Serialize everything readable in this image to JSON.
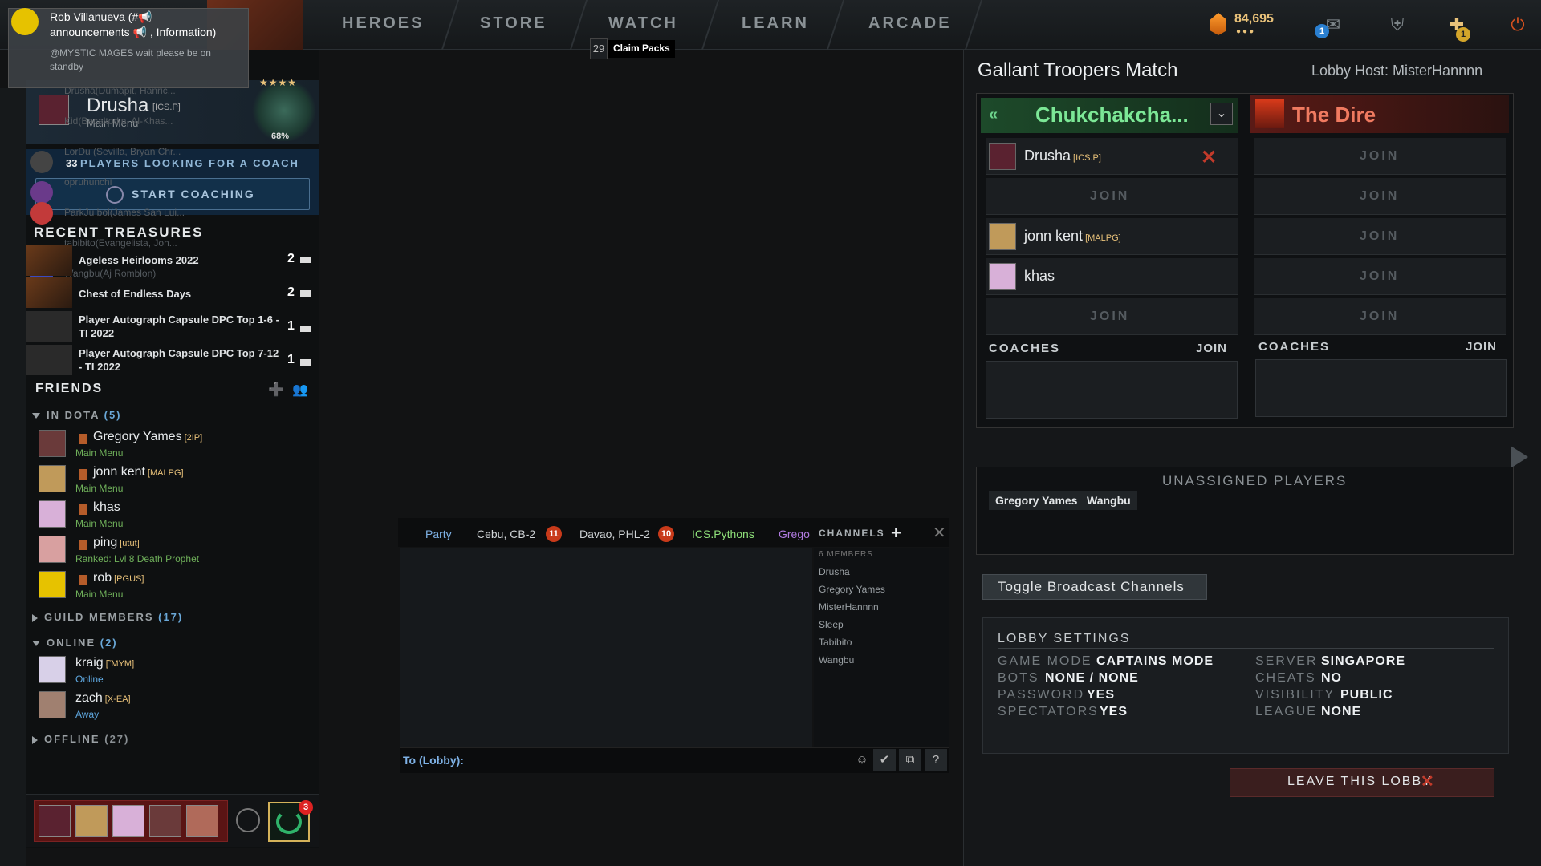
{
  "nav": {
    "items": [
      "HEROES",
      "STORE",
      "WATCH",
      "LEARN",
      "ARCADE"
    ],
    "claim_count": "29",
    "claim_label": "Claim Packs",
    "shards": "84,695",
    "shards_dots": "●●●",
    "mail_badge": "1",
    "plus_badge": "1",
    "icons": [
      "shards-icon",
      "mail-icon",
      "armory-icon",
      "plus-icon",
      "power-icon"
    ]
  },
  "notification": {
    "title": "Rob Villanueva (#📢 announcements 📢 , Information)",
    "message": "@MYSTIC MAGES wait please be on standby"
  },
  "profile": {
    "name": "Drusha",
    "tag": "[ICS.P]",
    "status": "Main Menu",
    "rank_pct": "68%",
    "rank_stars": "★★★★"
  },
  "coach": {
    "count": "33",
    "label": "PLAYERS LOOKING FOR A COACH",
    "button": "START COACHING"
  },
  "ghost_friends": [
    "Drusha(Dumapit, Hanric...",
    "Kid(Bacaltodin, Al-Khas...",
    "LorDu (Sevilla, Bryan Chr...",
    "opruhunchi",
    "ParkJu bol(James San Lui...",
    "tabibito(Evangelista, Joh...",
    "Wangbu(Aj Romblon)"
  ],
  "treasures": {
    "title": "RECENT TREASURES",
    "items": [
      {
        "name": "Ageless Heirlooms 2022",
        "count": "2"
      },
      {
        "name": "Chest of Endless Days",
        "count": "2"
      },
      {
        "name": "Player Autograph Capsule DPC Top 1-6 - TI 2022",
        "count": "1"
      },
      {
        "name": "Player Autograph Capsule DPC Top 7-12 - TI 2022",
        "count": "1"
      }
    ]
  },
  "friends": {
    "title": "FRIENDS",
    "in_dota": {
      "label": "IN DOTA",
      "count": "(5)"
    },
    "in_dota_list": [
      {
        "name": "Gregory Yames",
        "tag": "[2IP]",
        "status": "Main Menu"
      },
      {
        "name": "jonn kent",
        "tag": "[MALPG]",
        "status": "Main Menu"
      },
      {
        "name": "khas",
        "tag": "",
        "status": "Main Menu"
      },
      {
        "name": "ping",
        "tag": "[utut]",
        "status": "Ranked: Lvl 8 Death Prophet"
      },
      {
        "name": "rob",
        "tag": "[PGUS]",
        "status": "Main Menu"
      }
    ],
    "guild": {
      "label": "GUILD MEMBERS",
      "count": "(17)"
    },
    "online": {
      "label": "ONLINE",
      "count": "(2)"
    },
    "online_list": [
      {
        "name": "kraig",
        "tag": "[˜MYM]",
        "status": "Online"
      },
      {
        "name": "zach",
        "tag": "[X-EA]",
        "status": "Away"
      }
    ],
    "offline": {
      "label": "OFFLINE",
      "count": "(27)"
    }
  },
  "party": {
    "badge": "3"
  },
  "chat": {
    "tabs": [
      {
        "label": "Party",
        "color": "#7fb2e6"
      },
      {
        "label": "Cebu, CB-2",
        "color": "#cfd3d6",
        "badge": "11"
      },
      {
        "label": "Davao, PHL-2",
        "color": "#cfd3d6",
        "badge": "10"
      },
      {
        "label": "ICS.Pythons",
        "color": "#8fe07a"
      },
      {
        "label": "Grego",
        "color": "#b07ae0"
      }
    ],
    "channels_label": "CHANNELS",
    "members_head": "6 MEMBERS",
    "members": [
      "Drusha",
      "Gregory Yames",
      "MisterHannnn",
      "Sleep",
      "Tabibito",
      "Wangbu"
    ],
    "to_label": "To (Lobby):"
  },
  "lobby": {
    "title": "Gallant Troopers Match",
    "host": "Lobby Host: MisterHannnn",
    "radiant": {
      "name": "Chukchakcha...",
      "players": [
        {
          "name": "Drusha",
          "tag": "[ICS.P]"
        },
        {
          "join": "JOIN"
        },
        {
          "name": "jonn kent",
          "tag": "[MALPG]"
        },
        {
          "name": "khas",
          "tag": ""
        },
        {
          "join": "JOIN"
        }
      ]
    },
    "dire": {
      "name": "The Dire",
      "slots": [
        "JOIN",
        "JOIN",
        "JOIN",
        "JOIN",
        "JOIN"
      ]
    },
    "coaches_label": "COACHES",
    "coaches_join": "JOIN",
    "unassigned_title": "UNASSIGNED PLAYERS",
    "unassigned": [
      "Gregory Yames",
      "Wangbu"
    ],
    "broadcast_btn": "Toggle Broadcast Channels",
    "settings": {
      "title": "LOBBY SETTINGS",
      "left": [
        {
          "k": "GAME MODE",
          "v": "CAPTAINS MODE"
        },
        {
          "k": "BOTS",
          "v": "NONE / NONE"
        },
        {
          "k": "PASSWORD",
          "v": "YES"
        },
        {
          "k": "SPECTATORS",
          "v": "YES"
        }
      ],
      "right": [
        {
          "k": "SERVER",
          "v": "SINGAPORE"
        },
        {
          "k": "CHEATS",
          "v": "NO"
        },
        {
          "k": "VISIBILITY",
          "v": "PUBLIC"
        },
        {
          "k": "LEAGUE",
          "v": "NONE"
        }
      ]
    },
    "leave": "LEAVE THIS LOBBY"
  }
}
